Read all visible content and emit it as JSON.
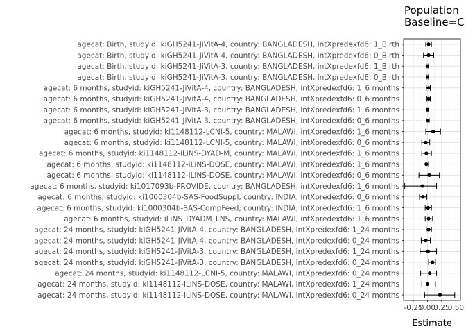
{
  "chart_data": {
    "type": "forest",
    "title": "Population\nBaseline=C",
    "xlabel": "Estimate",
    "ylabel": "",
    "xlim": [
      -0.42,
      0.58
    ],
    "x_ticks": [
      -0.25,
      0.0,
      0.25,
      0.5
    ],
    "x_tick_labels": [
      "-0.25",
      "0.00",
      "0.25",
      "0.50"
    ],
    "grid": true,
    "categories": [
      "agecat: Birth, studyid: kiGH5241-JiVitA-4, country: BANGLADESH, intXpredexfd6: 1_Birth",
      "agecat: Birth, studyid: kiGH5241-JiVitA-4, country: BANGLADESH, intXpredexfd6: 0_Birth",
      "agecat: Birth, studyid: kiGH5241-JiVitA-3, country: BANGLADESH, intXpredexfd6: 1_Birth",
      "agecat: Birth, studyid: kiGH5241-JiVitA-3, country: BANGLADESH, intXpredexfd6: 0_Birth",
      "agecat: 6 months, studyid: kiGH5241-JiVitA-4, country: BANGLADESH, intXpredexfd6: 1_6 months",
      "agecat: 6 months, studyid: kiGH5241-JiVitA-4, country: BANGLADESH, intXpredexfd6: 0_6 months",
      "agecat: 6 months, studyid: kiGH5241-JiVitA-3, country: BANGLADESH, intXpredexfd6: 1_6 months",
      "agecat: 6 months, studyid: kiGH5241-JiVitA-3, country: BANGLADESH, intXpredexfd6: 0_6 months",
      "agecat: 6 months, studyid: ki1148112-LCNI-5, country: MALAWI, intXpredexfd6: 1_6 months",
      "agecat: 6 months, studyid: ki1148112-LCNI-5, country: MALAWI, intXpredexfd6: 0_6 months",
      "agecat: 6 months, studyid: ki1148112-iLiNS-DYAD-M, country: MALAWI, intXpredexfd6: 1_6 months",
      "agecat: 6 months, studyid: ki1148112-iLiNS-DOSE, country: MALAWI, intXpredexfd6: 1_6 months",
      "agecat: 6 months, studyid: ki1148112-iLiNS-DOSE, country: MALAWI, intXpredexfd6: 0_6 months",
      "agecat: 6 months, studyid: ki1017093b-PROVIDE, country: BANGLADESH, intXpredexfd6: 1_6 months",
      "agecat: 6 months, studyid: ki1000304b-SAS-FoodSuppl, country: INDIA, intXpredexfd6: 0_6 months",
      "agecat: 6 months, studyid: ki1000304b-SAS-CompFeed, country: INDIA, intXpredexfd6: 1_6 months",
      "agecat: 6 months, studyid: iLiNS_DYADM_LNS, country: MALAWI, intXpredexfd6: 1_6 months",
      "agecat: 24 months, studyid: kiGH5241-JiVitA-4, country: BANGLADESH, intXpredexfd6: 1_24 months",
      "agecat: 24 months, studyid: kiGH5241-JiVitA-4, country: BANGLADESH, intXpredexfd6: 0_24 months",
      "agecat: 24 months, studyid: kiGH5241-JiVitA-3, country: BANGLADESH, intXpredexfd6: 1_24 months",
      "agecat: 24 months, studyid: kiGH5241-JiVitA-3, country: BANGLADESH, intXpredexfd6: 0_24 months",
      "agecat: 24 months, studyid: ki1148112-LCNI-5, country: MALAWI, intXpredexfd6: 0_24 months",
      "agecat: 24 months, studyid: ki1148112-iLiNS-DOSE, country: MALAWI, intXpredexfd6: 1_24 months",
      "agecat: 24 months, studyid: ki1148112-iLiNS-DOSE, country: MALAWI, intXpredexfd6: 0_24 months"
    ],
    "estimate": [
      0.02,
      0.02,
      0.0,
      0.0,
      0.02,
      0.02,
      0.0,
      0.01,
      0.1,
      -0.03,
      -0.02,
      -0.02,
      0.03,
      -0.09,
      -0.08,
      0.01,
      0.02,
      0.02,
      -0.03,
      0.01,
      0.09,
      0.04,
      0.0,
      0.22
    ],
    "ci_lower": [
      -0.03,
      -0.07,
      -0.02,
      -0.02,
      -0.02,
      -0.01,
      -0.02,
      -0.02,
      -0.03,
      -0.1,
      -0.1,
      -0.06,
      -0.15,
      -0.4,
      -0.14,
      -0.04,
      -0.04,
      -0.02,
      -0.11,
      -0.13,
      0.02,
      -0.12,
      -0.1,
      -0.05
    ],
    "ci_upper": [
      0.07,
      0.11,
      0.02,
      0.02,
      0.05,
      0.05,
      0.02,
      0.03,
      0.23,
      0.04,
      0.07,
      0.02,
      0.21,
      0.16,
      -0.01,
      0.07,
      0.09,
      0.07,
      0.05,
      0.16,
      0.14,
      0.16,
      0.14,
      0.48
    ]
  }
}
